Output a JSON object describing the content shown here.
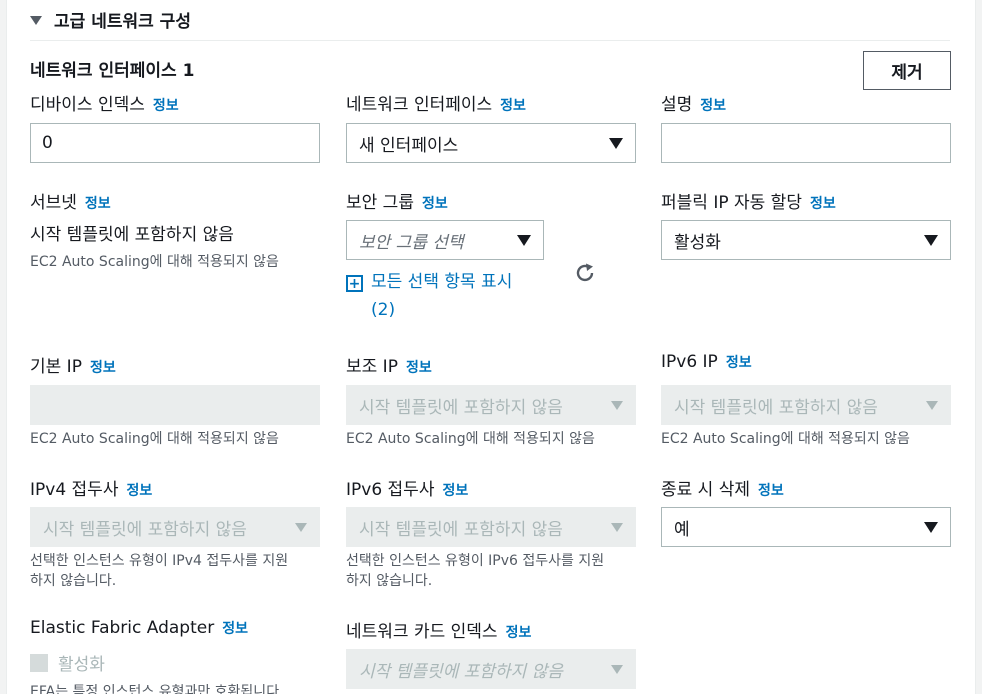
{
  "section": {
    "title": "고급 네트워크 구성"
  },
  "interface": {
    "title": "네트워크 인터페이스 1",
    "remove_label": "제거"
  },
  "info_label": "정보",
  "fields": {
    "device_index": {
      "label": "디바이스 인덱스",
      "value": "0"
    },
    "network_interface": {
      "label": "네트워크 인터페이스",
      "value": "새 인터페이스"
    },
    "description": {
      "label": "설명",
      "value": ""
    },
    "subnet": {
      "label": "서브넷",
      "value": "시작 템플릿에 포함하지 않음",
      "desc": "EC2 Auto Scaling에 대해 적용되지 않음"
    },
    "security_group": {
      "label": "보안 그룹",
      "placeholder": "보안 그룹 선택",
      "show_all_line1": "모든 선택 항목 표시",
      "show_all_line2": "(2)"
    },
    "public_ip": {
      "label": "퍼블릭 IP 자동 할당",
      "value": "활성화"
    },
    "primary_ip": {
      "label": "기본 IP",
      "desc": "EC2 Auto Scaling에 대해 적용되지 않음"
    },
    "secondary_ip": {
      "label": "보조 IP",
      "value": "시작 템플릿에 포함하지 않음",
      "desc": "EC2 Auto Scaling에 대해 적용되지 않음"
    },
    "ipv6_ip": {
      "label": "IPv6 IP",
      "value": "시작 템플릿에 포함하지 않음",
      "desc": "EC2 Auto Scaling에 대해 적용되지 않음"
    },
    "ipv4_prefix": {
      "label": "IPv4 접두사",
      "value": "시작 템플릿에 포함하지 않음",
      "desc_line1": "선택한 인스턴스 유형이 IPv4 접두사를 지원",
      "desc_line2": "하지 않습니다."
    },
    "ipv6_prefix": {
      "label": "IPv6 접두사",
      "value": "시작 템플릿에 포함하지 않음",
      "desc_line1": "선택한 인스턴스 유형이 IPv6 접두사를 지원",
      "desc_line2": "하지 않습니다."
    },
    "delete_on_termination": {
      "label": "종료 시 삭제",
      "value": "예"
    },
    "efa": {
      "label": "Elastic Fabric Adapter",
      "checkbox_label": "활성화",
      "desc": "EFA는 특정 인스턴스 유형과만 호환됩니다"
    },
    "network_card_index": {
      "label": "네트워크 카드 인덱스",
      "value": "시작 템플릿에 포함하지 않음"
    }
  }
}
